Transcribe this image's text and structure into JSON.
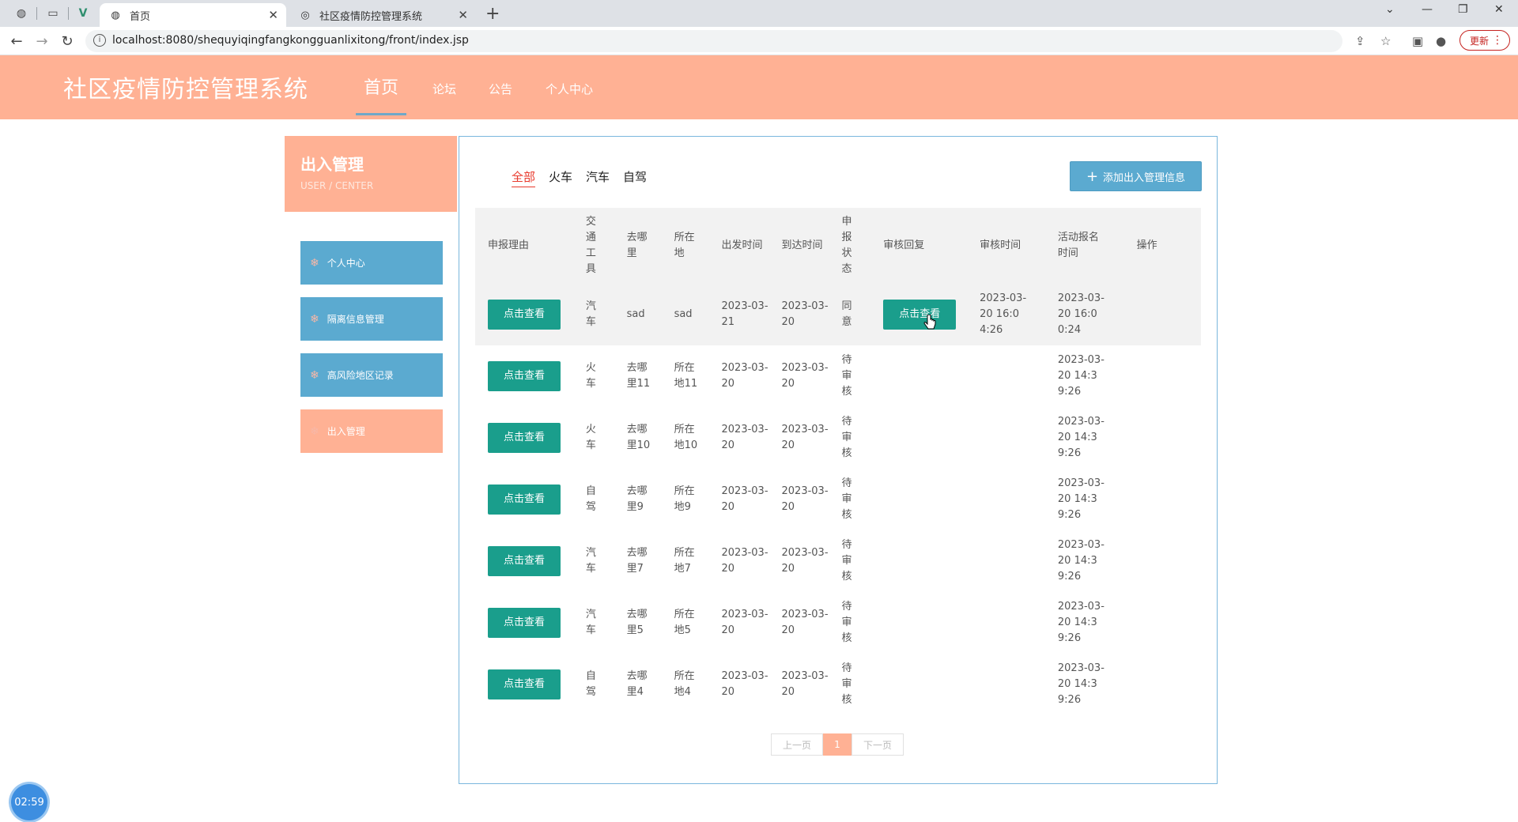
{
  "browser": {
    "tabs": [
      {
        "title": "首页"
      },
      {
        "title": "社区疫情防控管理系统"
      }
    ],
    "url": "localhost:8080/shequyiqingfangkongguanlixitong/front/index.jsp",
    "update_label": "更新"
  },
  "site": {
    "title": "社区疫情防控管理系统",
    "nav": {
      "home": "首页",
      "forum": "论坛",
      "notice": "公告",
      "center": "个人中心"
    }
  },
  "sidebar": {
    "title": "出入管理",
    "subtitle": "USER / CENTER",
    "items": [
      {
        "label": "个人中心"
      },
      {
        "label": "隔离信息管理"
      },
      {
        "label": "高风险地区记录"
      },
      {
        "label": "出入管理"
      }
    ]
  },
  "filters": [
    "全部",
    "火车",
    "汽车",
    "自驾"
  ],
  "add_button": "添加出入管理信息",
  "table": {
    "headers": {
      "reason": "申报理由",
      "tool": "交通工具",
      "dest": "去哪里",
      "loc": "所在地",
      "dep": "出发时间",
      "arr": "到达时间",
      "status": "申报状态",
      "reply": "审核回复",
      "rtime": "审核时间",
      "atime": "活动报名时间",
      "op": "操作"
    },
    "view_label": "点击查看",
    "rows": [
      {
        "tool": "汽车",
        "dest": "sad",
        "loc": "sad",
        "dep": "2023-03-21",
        "arr": "2023-03-20",
        "status": "同意",
        "reply": "点击查看",
        "rtime": "2023-03-20 16:04:26",
        "atime": "2023-03-20 16:00:24"
      },
      {
        "tool": "火车",
        "dest": "去哪里11",
        "loc": "所在地11",
        "dep": "2023-03-20",
        "arr": "2023-03-20",
        "status": "待审核",
        "reply": "",
        "rtime": "",
        "atime": "2023-03-20 14:39:26"
      },
      {
        "tool": "火车",
        "dest": "去哪里10",
        "loc": "所在地10",
        "dep": "2023-03-20",
        "arr": "2023-03-20",
        "status": "待审核",
        "reply": "",
        "rtime": "",
        "atime": "2023-03-20 14:39:26"
      },
      {
        "tool": "自驾",
        "dest": "去哪里9",
        "loc": "所在地9",
        "dep": "2023-03-20",
        "arr": "2023-03-20",
        "status": "待审核",
        "reply": "",
        "rtime": "",
        "atime": "2023-03-20 14:39:26"
      },
      {
        "tool": "汽车",
        "dest": "去哪里7",
        "loc": "所在地7",
        "dep": "2023-03-20",
        "arr": "2023-03-20",
        "status": "待审核",
        "reply": "",
        "rtime": "",
        "atime": "2023-03-20 14:39:26"
      },
      {
        "tool": "汽车",
        "dest": "去哪里5",
        "loc": "所在地5",
        "dep": "2023-03-20",
        "arr": "2023-03-20",
        "status": "待审核",
        "reply": "",
        "rtime": "",
        "atime": "2023-03-20 14:39:26"
      },
      {
        "tool": "自驾",
        "dest": "去哪里4",
        "loc": "所在地4",
        "dep": "2023-03-20",
        "arr": "2023-03-20",
        "status": "待审核",
        "reply": "",
        "rtime": "",
        "atime": "2023-03-20 14:39:26"
      }
    ]
  },
  "pager": {
    "prev": "上一页",
    "current": "1",
    "next": "下一页"
  },
  "timer": "02:59",
  "colors": {
    "header_bg": "#ffb194",
    "sidebar_item": "#5baad0",
    "view_button": "#1a9e8c",
    "filter_active": "#e8392c"
  }
}
